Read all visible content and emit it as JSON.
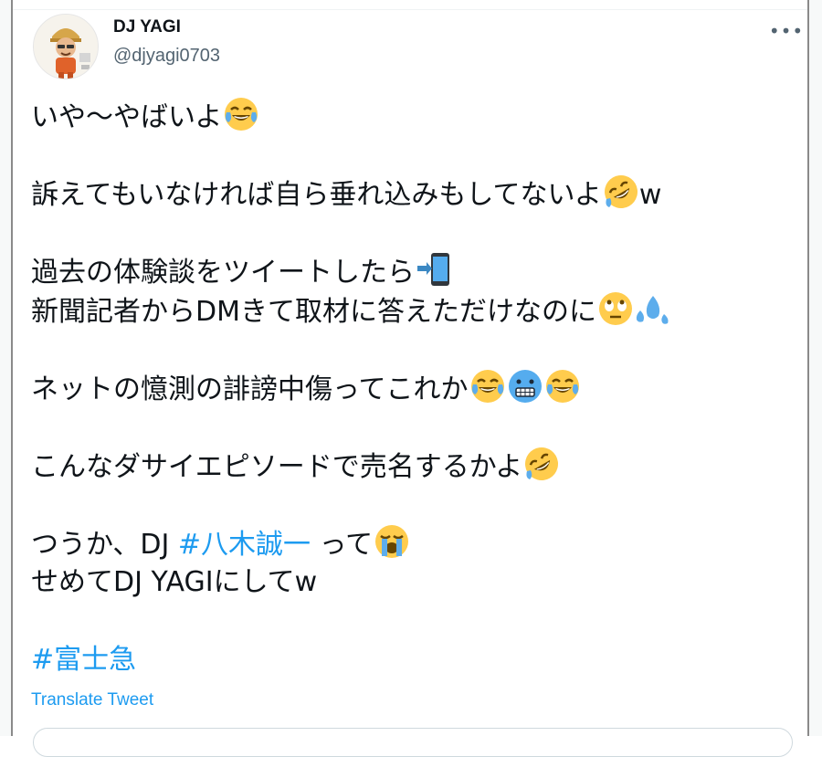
{
  "author": {
    "display_name": "DJ YAGI",
    "handle": "@djyagi0703"
  },
  "icons": {
    "more": "more-options-icon",
    "avatar": "avatar"
  },
  "tweet": {
    "line1": "いや～やばいよ",
    "line2_text": "訴えてもいなければ自ら垂れ込みもしてないよ",
    "line2_tail": "w",
    "line3": "過去の体験談をツイートしたら",
    "line4": "新聞記者からDMきて取材に答えただけなのに",
    "line5": "ネットの憶測の誹謗中傷ってこれか",
    "line6": "こんなダサイエピソードで売名するかよ",
    "line7_pre": "つうか、DJ ",
    "line7_hashtag": "#八木誠一",
    "line7_post": " って",
    "line8": "せめてDJ YAGIにしてw",
    "line9_hashtag": "#富士急"
  },
  "translate_label": "Translate Tweet",
  "colors": {
    "link": "#1d9bf0",
    "text": "#0f1419",
    "secondary": "#536471"
  }
}
